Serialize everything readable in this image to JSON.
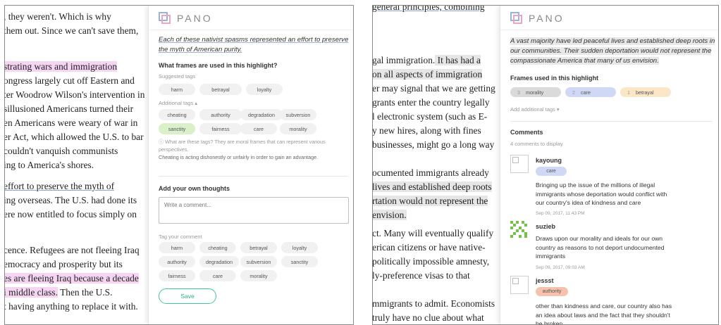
{
  "brand": "PANO",
  "left": {
    "article_lines": [
      {
        "text": ", they weren't. Which is why",
        "hl": ""
      },
      {
        "text": "them out. Since we can't save them,",
        "hl": ""
      },
      {
        "text": "strating wars and immigration",
        "hl": "pink"
      },
      {
        "text": "ongress largely cut off Eastern and",
        "hl": ""
      },
      {
        "text": "ter Woodrow Wilson's intervention in",
        "hl": ""
      },
      {
        "text": "sillusioned Americans turned their",
        "hl": ""
      },
      {
        "text": "en Americans were weary of war in",
        "hl": ""
      },
      {
        "text": "er Act, which allowed the U.S. to bar",
        "hl": ""
      },
      {
        "text": "couldn't vanquish communists",
        "hl": ""
      },
      {
        "text": "ing to America's shores.",
        "hl": ""
      },
      {
        "text": "effort to preserve the myth of",
        "hl": "underline"
      },
      {
        "text": "ing overseas. The U.S. had done its",
        "hl": ""
      },
      {
        "text": "ere now entitled to focus simply on",
        "hl": ""
      },
      {
        "text": "cence. Refugees are not fleeing Iraq",
        "hl": ""
      },
      {
        "text": "emocracy and prosperity but its",
        "hl": ""
      },
      {
        "text": "es are fleeing Iraq because a decade",
        "hl": "pink"
      },
      {
        "text": "i middle class.",
        "hl": "pink"
      },
      {
        "text": "t having anything to replace it with.",
        "hl": ""
      }
    ],
    "extra_fragment": " Then the U.S.",
    "quote": "Each of these nativist spasms represented an effort to preserve the myth of American purity.",
    "question": "What frames are used in this highlight?",
    "suggested_label": "Suggested tags",
    "suggested_tags": [
      "harm",
      "betrayal",
      "loyalty"
    ],
    "additional_label": "Additional tags ▴",
    "additional_tags": [
      "cheating",
      "authority",
      "degradation",
      "subversion",
      "sanctity",
      "fairness",
      "care",
      "morality"
    ],
    "info_text": "ⓘ What are these tags? They are moral frames that can represent various perspectives.",
    "def_text": "Cheating is acting dishonestly or unfairly in order to gain an advantage.",
    "thoughts_heading": "Add your own thoughts",
    "comment_placeholder": "Write a comment...",
    "tag_comment_label": "Tag your comment",
    "comment_tags": [
      "harm",
      "cheating",
      "betrayal",
      "loyalty",
      "authority",
      "degradation",
      "subversion",
      "sanctity",
      "fairness",
      "care",
      "morality"
    ],
    "save_label": "Save"
  },
  "right": {
    "article_lines": [
      {
        "text": "general principles, combining",
        "hl": "cut"
      },
      {
        "text": "gal immigration.",
        "hl": ""
      },
      {
        "text": "on all aspects of immigration",
        "hl": "grey"
      },
      {
        "text": "er may signal that we are getting",
        "hl": ""
      },
      {
        "text": "grants enter the country legally",
        "hl": ""
      },
      {
        "text": "l electronic system (such as E-",
        "hl": ""
      },
      {
        "text": "y new hires, along with fines",
        "hl": ""
      },
      {
        "text": "businesses, might go a long way",
        "hl": ""
      },
      {
        "text": "ocumented immigrants already",
        "hl": ""
      },
      {
        "text": "lives and established deep roots",
        "hl": "grey"
      },
      {
        "text": "rtation would not represent the",
        "hl": "grey"
      },
      {
        "text": "envision.",
        "hl": "grey"
      },
      {
        "text": "ct. Many will eventually qualify",
        "hl": ""
      },
      {
        "text": "erican citizens or have native-",
        "hl": ""
      },
      {
        "text": "politically impossible amnesty,",
        "hl": ""
      },
      {
        "text": "ly-preference visas to that",
        "hl": ""
      },
      {
        "text": "mmigrants to admit. Economists",
        "hl": ""
      },
      {
        "text": "truly have no clue about what",
        "hl": ""
      }
    ],
    "extra_fragment": " It has had a",
    "quote": "A vast majority have led peaceful lives and established deep roots in our communities. Their sudden deportation would not represent the compassionate America that many of us envision.",
    "frames_heading": "Frames used in this highlight",
    "frames": [
      {
        "count": "3",
        "name": "morality",
        "color": "grey"
      },
      {
        "count": "2",
        "name": "care",
        "color": "blue"
      },
      {
        "count": "1",
        "name": "betrayal",
        "color": "peach"
      }
    ],
    "add_tags_label": "Add additional tags ▾",
    "comments_heading": "Comments",
    "comments_count": "4 comments to display",
    "comments": [
      {
        "user": "kayoung",
        "tag": "care",
        "text": "Bringing up the issue of the millions of illegal\nimmigrants whose deportation would conflict with\nour country's idea of kindness and care",
        "time": "Sep 09, 2017, 11:43 PM"
      },
      {
        "user": "suzieb",
        "tag": "",
        "text": "Draws upon our morality and ideals for our own\ncountry as reasons to not deport undocumented\nimmigrants",
        "time": "Sep 09, 2017, 09:03 AM"
      },
      {
        "user": "jessst",
        "tag": "authority",
        "text": "other than kindness and care, our country also has\nan idea about laws and the fact that they shouldn't\nbe broken",
        "time": ""
      }
    ]
  }
}
